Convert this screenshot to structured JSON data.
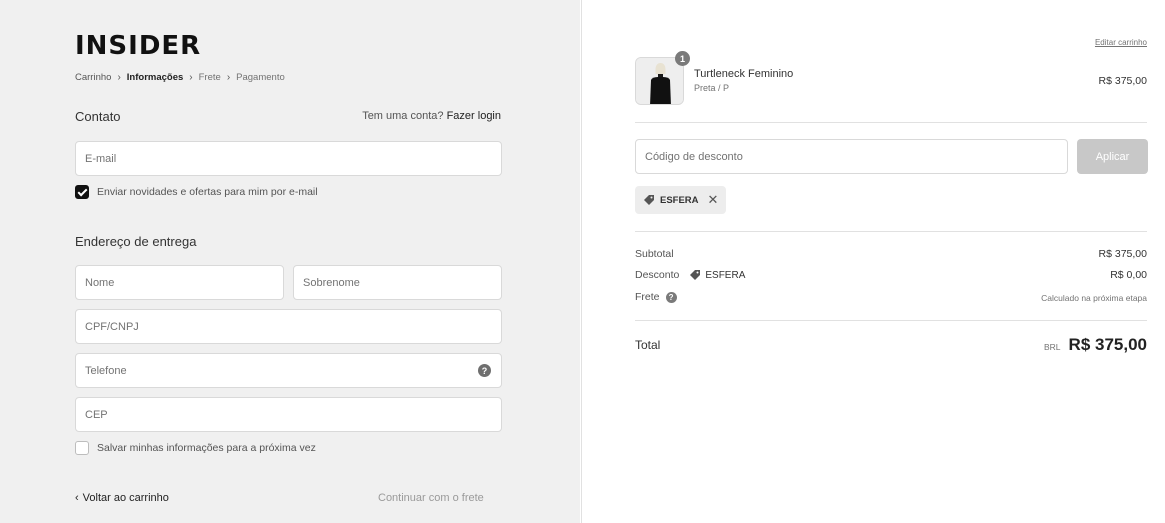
{
  "brand": {
    "logo_text": "INSIDER"
  },
  "breadcrumb": {
    "items": [
      "Carrinho",
      "Informações",
      "Frete",
      "Pagamento"
    ],
    "separator": ">"
  },
  "contact": {
    "title": "Contato",
    "login_prompt": "Tem uma conta?",
    "login_link": "Fazer login",
    "email_placeholder": "E-mail",
    "newsletter_label": "Enviar novidades e ofertas para mim por e-mail",
    "newsletter_checked": true
  },
  "shipping": {
    "title": "Endereço de entrega",
    "first_name_placeholder": "Nome",
    "last_name_placeholder": "Sobrenome",
    "cpf_placeholder": "CPF/CNPJ",
    "phone_placeholder": "Telefone",
    "cep_placeholder": "CEP",
    "save_info_label": "Salvar minhas informações para a próxima vez",
    "save_info_checked": false
  },
  "footer_nav": {
    "back_label": "Voltar ao carrinho",
    "continue_label": "Continuar com o frete"
  },
  "cart": {
    "edit_label": "Editar carrinho",
    "item": {
      "name": "Turtleneck Feminino",
      "variant": "Preta / P",
      "price": "R$ 375,00",
      "quantity": "1"
    }
  },
  "discount": {
    "placeholder": "Código de desconto",
    "apply_label": "Aplicar",
    "applied_code": "ESFERA"
  },
  "summary": {
    "subtotal_label": "Subtotal",
    "subtotal_value": "R$ 375,00",
    "discount_label": "Desconto",
    "discount_code": "ESFERA",
    "discount_value": "R$ 0,00",
    "shipping_label": "Frete",
    "shipping_value": "Calculado na próxima etapa",
    "total_label": "Total",
    "currency": "BRL",
    "total_value": "R$ 375,00"
  },
  "colors": {
    "left_bg": "#f0f0f0",
    "accent_dark": "#111111",
    "apply_disabled": "#c8c8c8"
  }
}
